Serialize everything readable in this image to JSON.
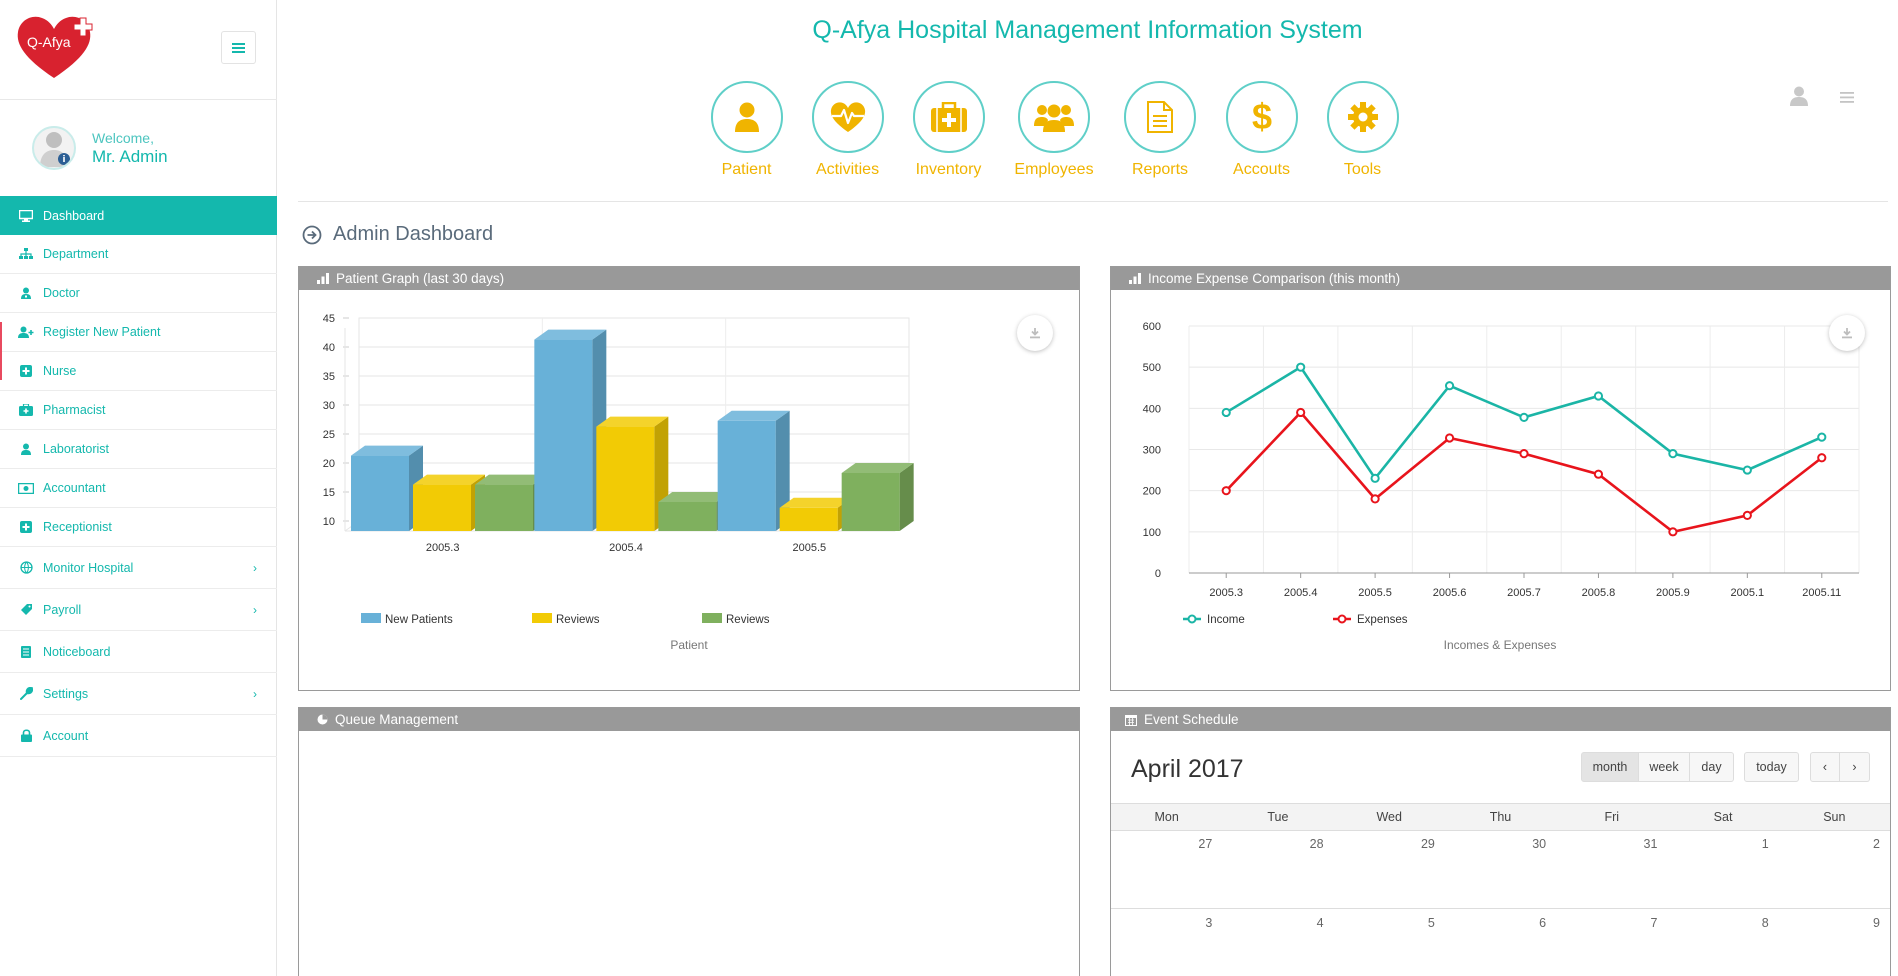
{
  "app": {
    "title": "Q-Afya Hospital Management Information System",
    "logo_text": "Q-Afya",
    "brand_color": "#14b8ad",
    "accent_color": "#f0b400"
  },
  "user": {
    "welcome_label": "Welcome,",
    "name": "Mr. Admin"
  },
  "sidebar": {
    "items": [
      {
        "label": "Dashboard",
        "icon": "monitor-icon",
        "active": true
      },
      {
        "label": "Department",
        "icon": "sitemap-icon"
      },
      {
        "label": "Doctor",
        "icon": "user-md-icon"
      },
      {
        "label": "Register New Patient",
        "icon": "user-plus-icon"
      },
      {
        "label": "Nurse",
        "icon": "plus-square-icon"
      },
      {
        "label": "Pharmacist",
        "icon": "medkit-icon"
      },
      {
        "label": "Laboratorist",
        "icon": "user-icon"
      },
      {
        "label": "Accountant",
        "icon": "money-icon"
      },
      {
        "label": "Receptionist",
        "icon": "plus-square-icon"
      },
      {
        "label": "Monitor Hospital",
        "icon": "globe-icon",
        "has_submenu": true
      },
      {
        "label": "Payroll",
        "icon": "tag-icon",
        "has_submenu": true
      },
      {
        "label": "Noticeboard",
        "icon": "list-icon"
      },
      {
        "label": "Settings",
        "icon": "wrench-icon",
        "has_submenu": true
      },
      {
        "label": "Account",
        "icon": "lock-icon"
      }
    ]
  },
  "modules": [
    {
      "label": "Patient",
      "icon": "user-icon"
    },
    {
      "label": "Activities",
      "icon": "heartbeat-icon"
    },
    {
      "label": "Inventory",
      "icon": "medkit-icon"
    },
    {
      "label": "Employees",
      "icon": "users-icon"
    },
    {
      "label": "Reports",
      "icon": "document-icon"
    },
    {
      "label": "Accouts",
      "icon": "dollar-icon"
    },
    {
      "label": "Tools",
      "icon": "gear-icon"
    }
  ],
  "page": {
    "title": "Admin Dashboard"
  },
  "panels": {
    "patient_graph": "Patient Graph (last 30 days)",
    "income_expense": "Income Expense Comparison (this month)",
    "queue": "Queue Management",
    "event": "Event Schedule"
  },
  "chart_data": [
    {
      "type": "bar",
      "title": "Patient Graph (last 30 days)",
      "caption": "Patient",
      "categories": [
        "2005.3",
        "2005.4",
        "2005.5"
      ],
      "series": [
        {
          "name": "New Patients",
          "values": [
            23,
            43,
            29
          ],
          "color": "#68b1d8"
        },
        {
          "name": "Reviews",
          "values": [
            18,
            28,
            14
          ],
          "color": "#f2cb05"
        },
        {
          "name": "Reviews",
          "values": [
            18,
            15,
            20
          ],
          "color": "#7fb05e"
        }
      ],
      "ylim": [
        10,
        45
      ],
      "yticks": [
        10,
        15,
        20,
        25,
        30,
        35,
        40,
        45
      ],
      "style": "3d",
      "grid": true,
      "legend": "bottom"
    },
    {
      "type": "line",
      "title": "Income Expense Comparison (this month)",
      "caption": "Incomes & Expenses",
      "categories": [
        "2005.3",
        "2005.4",
        "2005.5",
        "2005.6",
        "2005.7",
        "2005.8",
        "2005.9",
        "2005.1",
        "2005.11"
      ],
      "series": [
        {
          "name": "Income",
          "values": [
            390,
            500,
            230,
            455,
            378,
            430,
            290,
            250,
            330
          ],
          "color": "#1bb5a6"
        },
        {
          "name": "Expenses",
          "values": [
            200,
            390,
            180,
            328,
            290,
            240,
            100,
            140,
            280
          ],
          "color": "#e8141c"
        }
      ],
      "ylim": [
        0,
        600
      ],
      "yticks": [
        0,
        100,
        200,
        300,
        400,
        500,
        600
      ],
      "grid": true,
      "legend": "bottom"
    }
  ],
  "calendar": {
    "title": "April 2017",
    "view_buttons": [
      "month",
      "week",
      "day"
    ],
    "active_view": "month",
    "today_label": "today",
    "prev_label": "‹",
    "next_label": "›",
    "days_of_week": [
      "Mon",
      "Tue",
      "Wed",
      "Thu",
      "Fri",
      "Sat",
      "Sun"
    ],
    "weeks": [
      [
        "27",
        "28",
        "29",
        "30",
        "31",
        "1",
        "2"
      ],
      [
        "3",
        "4",
        "5",
        "6",
        "7",
        "8",
        "9"
      ]
    ]
  }
}
